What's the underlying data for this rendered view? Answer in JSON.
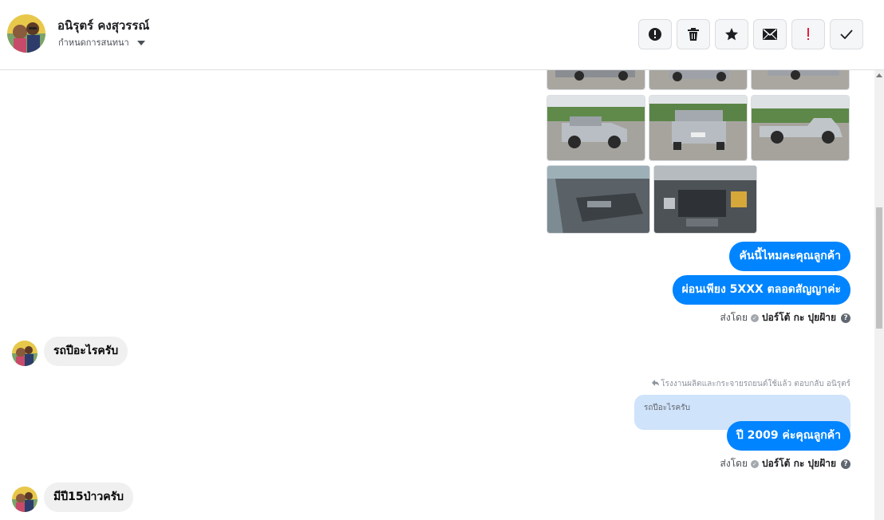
{
  "header": {
    "contact_name": "อนิรุตร์ คงสุวรรณ์",
    "assign_label": "กำหนดการสนทนา",
    "actions": [
      {
        "icon": "alert-circle-icon",
        "label": "Mark as spam"
      },
      {
        "icon": "trash-icon",
        "label": "Delete"
      },
      {
        "icon": "star-icon",
        "label": "Star"
      },
      {
        "icon": "envelope-icon",
        "label": "Mark as unread"
      },
      {
        "icon": "exclamation-icon",
        "label": "Flag"
      },
      {
        "icon": "checkmark-icon",
        "label": "Mark as done"
      }
    ]
  },
  "messages": {
    "out1": "คันนี้ไหมคะคุณลูกค้า",
    "out2": "ผ่อนเพียง 5XXX ตลอดสัญญาค่ะ",
    "sent_by_prefix": "ส่งโดย",
    "sent_by_name": "ปอร์โต้ กะ ปุยฝ้าย",
    "in1": "รถปีอะไรครับ",
    "reply_note": "โรงงานผลิตและกระจายรถยนต์ใช้แล้ว ตอบกลับ อนิรุตร์",
    "quoted_text": "รถปีอะไรครับ",
    "out3": "ปี 2009 ค่ะคุณลูกค้า",
    "sent_by_name_2": "ปอร์โต้ กะ ปุยฝ้าย",
    "in2": "มีปี15ป่าวครับ"
  },
  "colors": {
    "brand_blue": "#0084ff",
    "incoming_gray": "#f0f0f0",
    "quote_blue": "#cfe3fb",
    "flag_red": "#e41e3f"
  }
}
